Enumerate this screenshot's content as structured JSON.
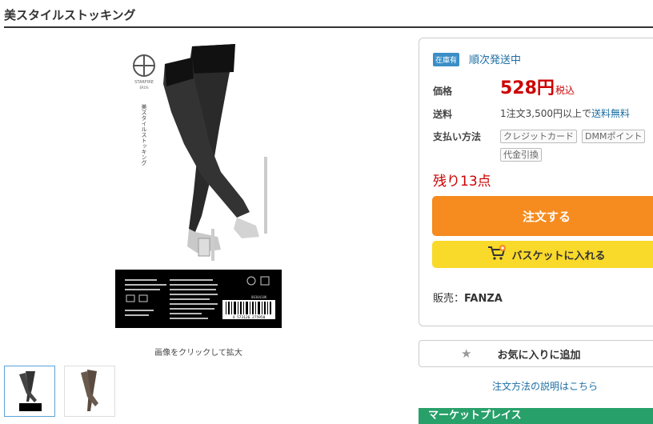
{
  "page": {
    "title": "美スタイルストッキング"
  },
  "gallery": {
    "zoom_hint": "画像をクリックして拡大",
    "package": {
      "brand": "STARFIRE",
      "brand_sub": "EROS",
      "vertical_title": "美スタイルストッキング",
      "product_code": "8830418K",
      "barcode_digits": "4 573126 275950"
    }
  },
  "buy_box": {
    "stock_badge": "在庫有",
    "stock_text": "順次発送中",
    "price_label": "価格",
    "price": "528円",
    "tax_label": "税込",
    "shipping_label": "送料",
    "shipping_text": "1注文3,500円以上で",
    "shipping_link": "送料無料",
    "payment_label": "支払い方法",
    "payment_methods": [
      "クレジットカード",
      "DMMポイント",
      "代金引換"
    ],
    "remaining": "残り13点",
    "order_button": "注文する",
    "basket_button": "バスケットに入れる",
    "seller_prefix": "販売：",
    "seller_name": "FANZA"
  },
  "favorite_button": "お気に入りに追加",
  "order_help_link": "注文方法の説明はこちら",
  "marketplace_header": "マーケットプレイス",
  "colors": {
    "accent_orange": "#f68b1f",
    "basket_yellow": "#f9d92a",
    "link_blue": "#1c6ea4",
    "price_red": "#cc0000",
    "market_green": "#28a06a"
  }
}
